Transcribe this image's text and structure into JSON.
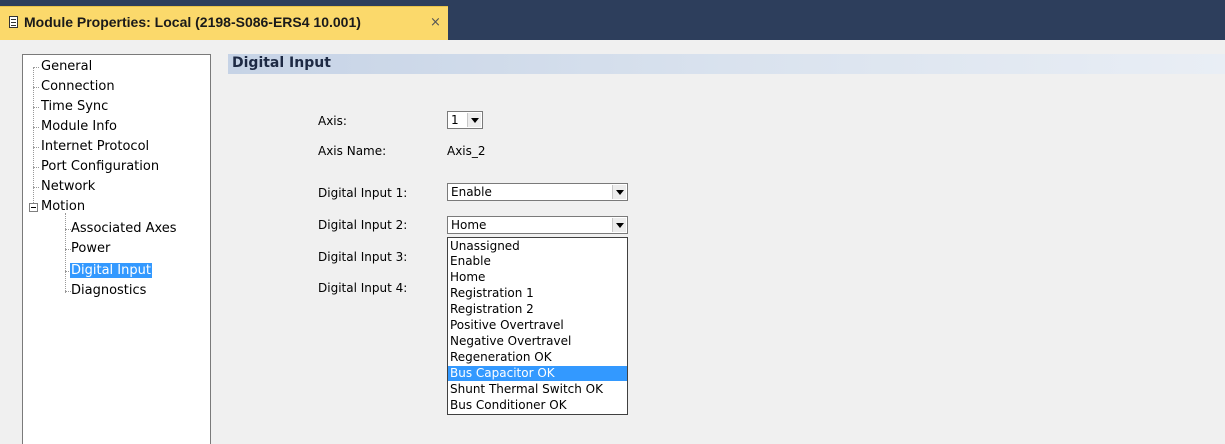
{
  "window": {
    "tab_title": "Module Properties: Local (2198-S086-ERS4 10.001)",
    "tab_close": "×"
  },
  "tree": {
    "items": [
      {
        "label": "General"
      },
      {
        "label": "Connection"
      },
      {
        "label": "Time Sync"
      },
      {
        "label": "Module Info"
      },
      {
        "label": "Internet Protocol"
      },
      {
        "label": "Port Configuration"
      },
      {
        "label": "Network"
      },
      {
        "label": "Motion",
        "expanded": true
      },
      {
        "label": "Associated Axes"
      },
      {
        "label": "Power"
      },
      {
        "label": "Digital Input",
        "selected": true
      },
      {
        "label": "Diagnostics"
      }
    ]
  },
  "section": {
    "title": "Digital Input"
  },
  "form": {
    "axis_label": "Axis:",
    "axis_value": "1",
    "axis_name_label": "Axis Name:",
    "axis_name_value": "Axis_2",
    "di1_label": "Digital Input 1:",
    "di1_value": "Enable",
    "di2_label": "Digital Input 2:",
    "di2_value": "Home",
    "di3_label": "Digital Input 3:",
    "di4_label": "Digital Input 4:"
  },
  "dropdown": {
    "options": [
      "Unassigned",
      "Enable",
      "Home",
      "Registration 1",
      "Registration 2",
      "Positive Overtravel",
      "Negative Overtravel",
      "Regeneration OK",
      "Bus Capacitor OK",
      "Shunt Thermal Switch OK",
      "Bus Conditioner OK"
    ],
    "highlighted": "Bus Capacitor OK"
  },
  "colors": {
    "title_bar": "#2d3e5c",
    "tab": "#fbd96b",
    "selection": "#3399ff"
  }
}
